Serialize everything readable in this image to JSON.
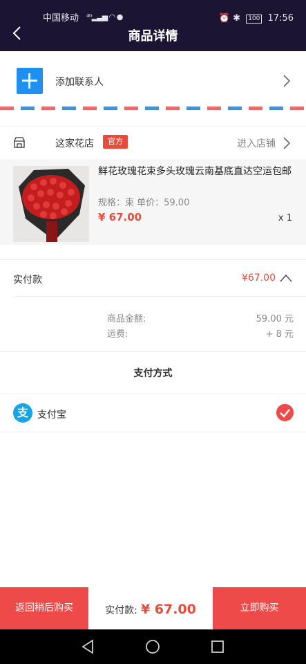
{
  "status": {
    "carrier": "中国移动",
    "network": "⁴ᴳ",
    "battery": "100",
    "time": "17:56"
  },
  "header": {
    "title": "商品详情"
  },
  "contact": {
    "label": "添加联系人"
  },
  "shop": {
    "name": "这家花店",
    "tag": "官方",
    "enter": "进入店铺"
  },
  "product": {
    "name": "鲜花玫瑰花束多头玫瑰云南基底直达空运包邮",
    "spec": "规格：束 单价：59.00",
    "price": "¥ 67.00",
    "qty": "x 1"
  },
  "amount": {
    "label": "实付款",
    "value": "¥67.00",
    "goods_label": "商品金额:",
    "goods_value": "59.00 元",
    "freight_label": "运费:",
    "freight_value": "+ 8 元"
  },
  "payment": {
    "title": "支付方式",
    "method": "支付宝",
    "method_icon": "支"
  },
  "bottom": {
    "back_label": "返回稍后购买",
    "total_label": "实付款:",
    "total_value": "¥ 67.00",
    "buy_label": "立即购买"
  },
  "colors": {
    "header": "#1b1533",
    "accent": "#ef4a4a",
    "blue": "#1f8ff0",
    "alipay": "#13a5e8"
  }
}
